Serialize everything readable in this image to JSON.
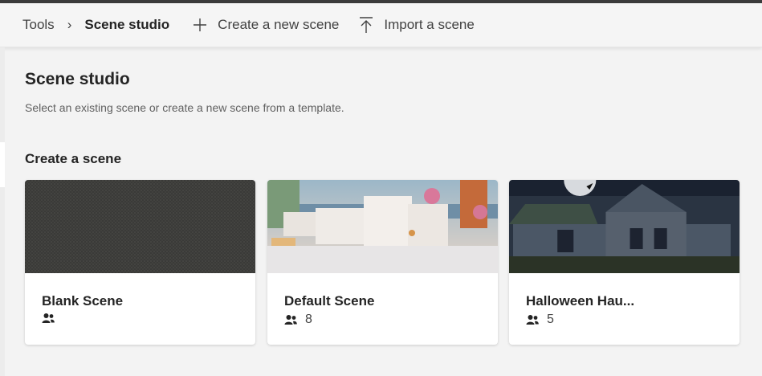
{
  "breadcrumb": {
    "root": "Tools",
    "separator": "›",
    "current": "Scene studio"
  },
  "commands": {
    "create": "Create a new scene",
    "import": "Import a scene"
  },
  "page": {
    "title": "Scene studio",
    "subtitle": "Select an existing scene or create a new scene from a template."
  },
  "section": {
    "title": "Create a scene"
  },
  "cards": [
    {
      "name": "Blank Scene",
      "participants": "",
      "icon": "people-icon"
    },
    {
      "name": "Default Scene",
      "participants": "8",
      "icon": "people-icon"
    },
    {
      "name": "Halloween Hau...",
      "participants": "5",
      "icon": "people-icon"
    }
  ],
  "colors": {
    "accent": "#242424",
    "background": "#f3f3f3",
    "card": "#ffffff"
  }
}
